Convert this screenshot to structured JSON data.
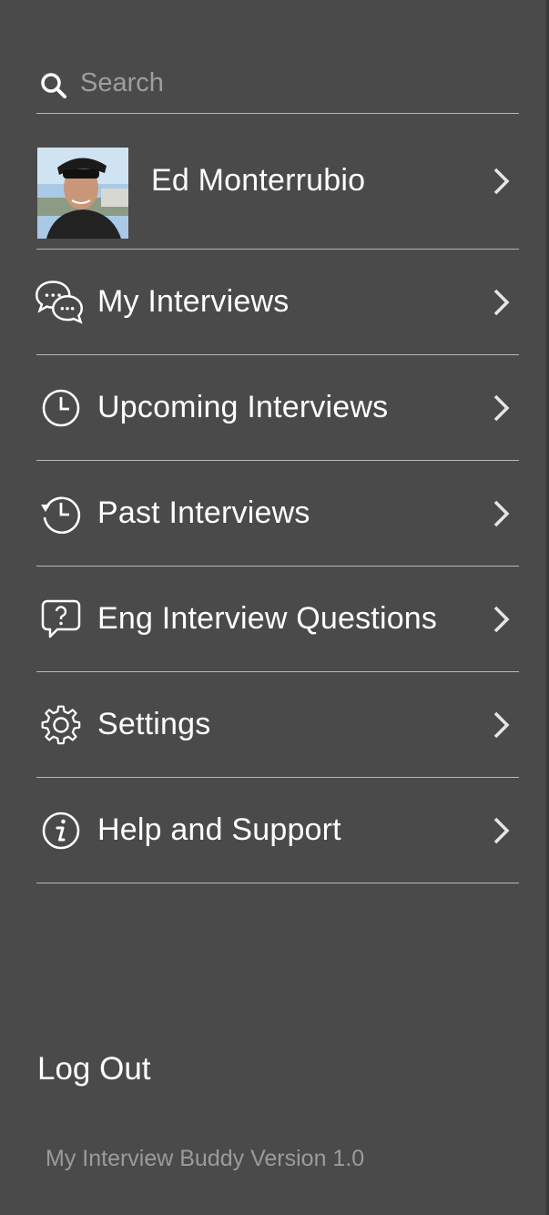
{
  "search": {
    "placeholder": "Search",
    "icon": "search-icon"
  },
  "profile": {
    "name": "Ed Monterrubio",
    "avatar": "user-avatar-photo"
  },
  "menu": [
    {
      "label": "My Interviews",
      "icon": "chat-bubbles-icon"
    },
    {
      "label": "Upcoming Interviews",
      "icon": "clock-icon"
    },
    {
      "label": "Past Interviews",
      "icon": "history-icon"
    },
    {
      "label": "Eng Interview Questions",
      "icon": "question-bubble-icon"
    },
    {
      "label": "Settings",
      "icon": "gear-icon"
    },
    {
      "label": "Help and Support",
      "icon": "info-icon"
    }
  ],
  "logout_label": "Log Out",
  "version_text": "My Interview Buddy Version 1.0",
  "colors": {
    "background": "#4a4a4a",
    "divider": "#b8b8b8",
    "text": "#ffffff",
    "muted": "#9b9b9b"
  }
}
